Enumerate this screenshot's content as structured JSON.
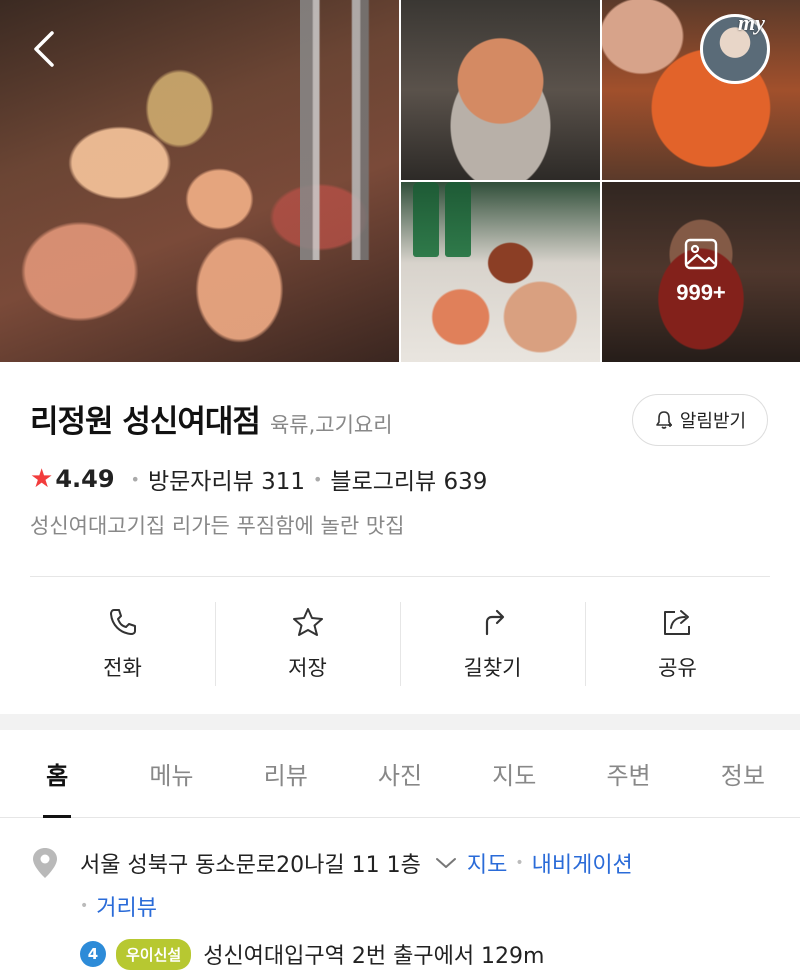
{
  "gallery": {
    "more_count": "999+",
    "my_tag": "my"
  },
  "place": {
    "name": "리정원 성신여대점",
    "category": "육류,고기요리",
    "alarm_label": "알림받기",
    "rating": "4.49",
    "visitor_reviews": "방문자리뷰 311",
    "blog_reviews": "블로그리뷰 639",
    "tagline": "성신여대고기집 리가든 푸짐함에 놀란 맛집"
  },
  "actions": [
    {
      "label": "전화",
      "icon": "phone-icon"
    },
    {
      "label": "저장",
      "icon": "star-icon"
    },
    {
      "label": "길찾기",
      "icon": "directions-icon"
    },
    {
      "label": "공유",
      "icon": "share-icon"
    }
  ],
  "tabs": [
    "홈",
    "메뉴",
    "리뷰",
    "사진",
    "지도",
    "주변",
    "정보"
  ],
  "address": {
    "text": "서울 성북구 동소문로20나길 11 1층",
    "map_link": "지도",
    "navigation_link": "내비게이션",
    "streetview_link": "거리뷰"
  },
  "subway": {
    "line": "4",
    "line_color": "#2d8bd8",
    "badge": "우이신설",
    "badge_color": "#b7c831",
    "text": "성신여대입구역 2번 출구에서 129m"
  }
}
